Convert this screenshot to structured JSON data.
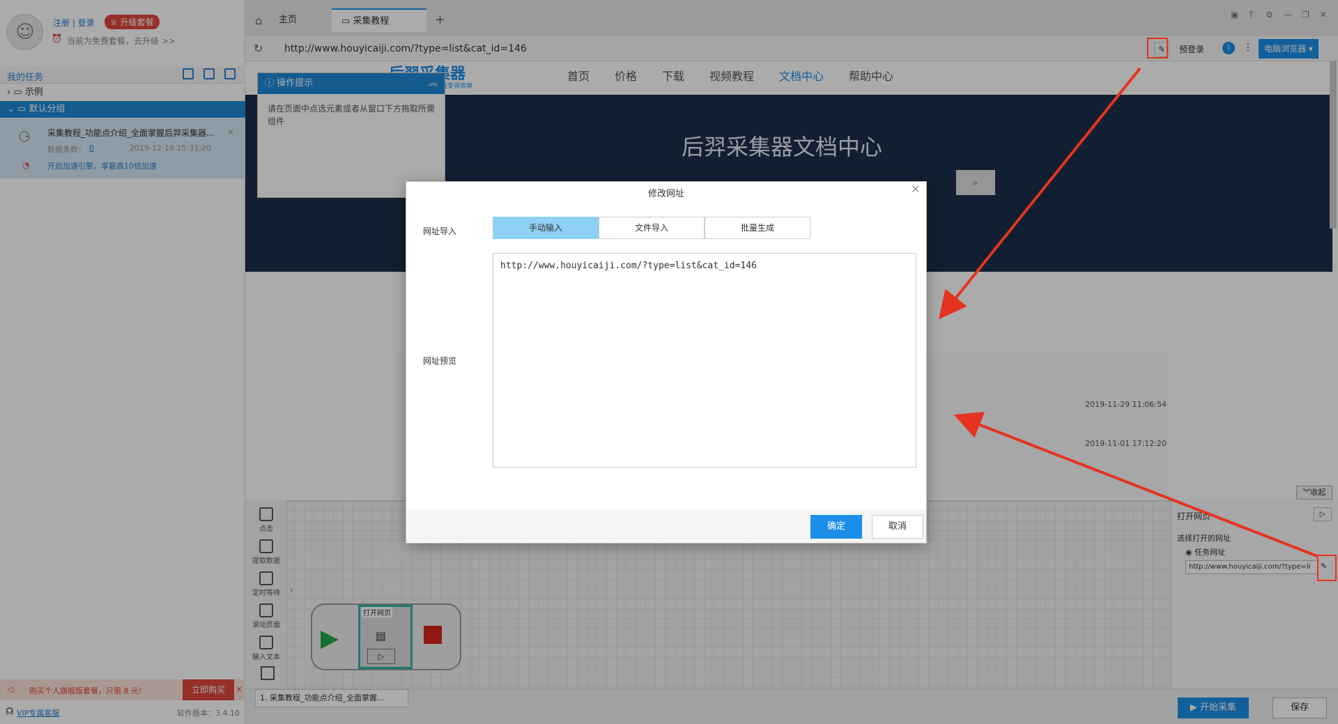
{
  "sidebar": {
    "register_login": "注册 | 登录",
    "upgrade_badge": "♕ 升级套餐",
    "plan_notice": "当前为免费套餐，去升级 >>",
    "my_tasks": "我的任务",
    "tree": [
      {
        "label": "示例"
      },
      {
        "label": "默认分组"
      }
    ],
    "task": {
      "title": "采集教程_功能点介绍_全面掌握后羿采集器...",
      "data_count_label": "数据条数：",
      "data_count": "0",
      "date": "2019-12-18 15:31:20",
      "accelerate": "开启加速引擎，享最高10倍加速"
    },
    "promo": "购买个人旗舰版套餐，只需 8 元!",
    "buy_now": "立即购买",
    "vip_service": "VIP专属客服",
    "version": "软件版本：3.4.10"
  },
  "browser": {
    "tabs": [
      {
        "label": "主页"
      },
      {
        "label": "采集教程_..."
      }
    ],
    "add_tab": "+",
    "address": "http://www.houyicaiji.com/?type=list&cat_id=146",
    "pre_login": "预登录",
    "browser_mode": "电脑浏览器 ▾"
  },
  "page": {
    "logo_text": "后羿采集器",
    "logo_sub": "数据变得简单",
    "nav": [
      "首页",
      "价格",
      "下载",
      "视频教程",
      "文档中心",
      "帮助中心"
    ],
    "hero_title": "后羿采集器文档中心",
    "dates": [
      "2019-11-29 11:06:54",
      "2019-11-01 17:12:20"
    ]
  },
  "tip": {
    "title": "操作提示",
    "body": "请在页面中点选元素或者从窗口下方拖取所需组件"
  },
  "designer": {
    "collapse": "收起",
    "tools": [
      "点击",
      "提取数据",
      "定时等待",
      "滚动页面",
      "输入文本"
    ],
    "node_label": "打开网页",
    "right_panel": {
      "title": "打开网页",
      "select_label": "选择打开的网址",
      "radio_label": "任务网址",
      "url_value": "http://www.houyicaiji.com/?type=li"
    },
    "footer_tab": "1. 采集教程_功能点介绍_全面掌握...",
    "start": "▶ 开始采集",
    "save": "保存"
  },
  "modal": {
    "title": "修改网址",
    "import_label": "网址导入",
    "segments": [
      "手动输入",
      "文件导入",
      "批量生成"
    ],
    "preview_label": "网址预览",
    "url_text": "http://www.houyicaiji.com/?type=list&cat_id=146",
    "confirm": "确定",
    "cancel": "取消"
  },
  "colors": {
    "accent": "#1a8ee8",
    "segment_active": "#8fd0f5",
    "annotation_red": "#e53322",
    "hero_bg": "#1c2d4a"
  }
}
